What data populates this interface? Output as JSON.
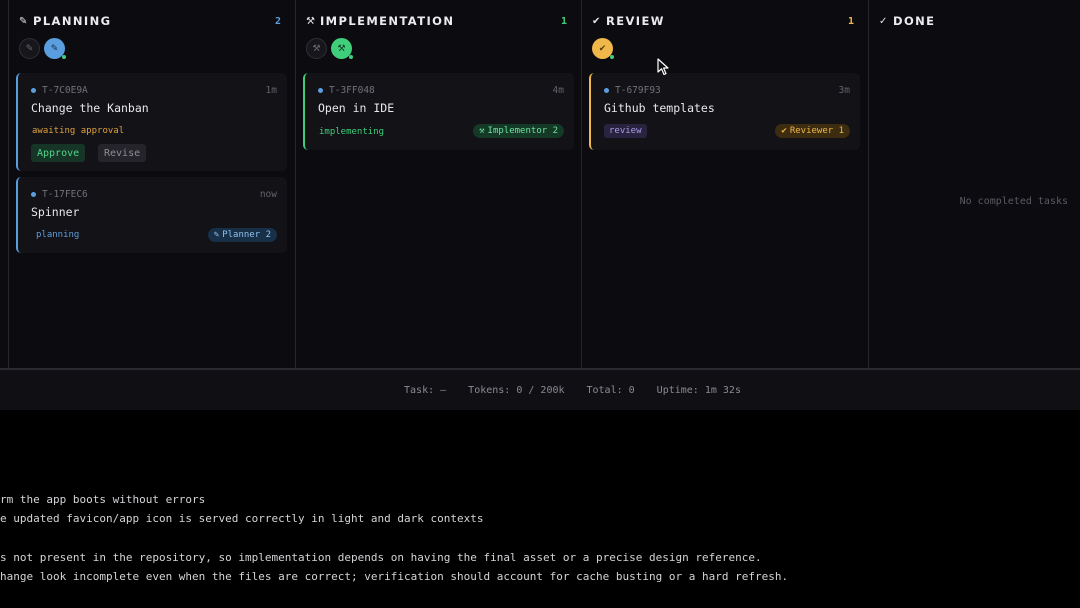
{
  "columns": [
    {
      "id": "planning",
      "glyph": "✎",
      "title": "PLANNING",
      "count": "2",
      "count_color": "#5b9ee0"
    },
    {
      "id": "implementation",
      "glyph": "⚒",
      "title": "IMPLEMENTATION",
      "count": "1",
      "count_color": "#3fcf7a"
    },
    {
      "id": "review",
      "glyph": "✔",
      "title": "REVIEW",
      "count": "1",
      "count_color": "#f0b84b"
    },
    {
      "id": "done",
      "glyph": "✓",
      "title": "DONE"
    }
  ],
  "avatars": {
    "planning": [
      {
        "icon": "✎"
      },
      {
        "icon": "✎"
      }
    ],
    "implementation": [
      {
        "icon": "⚒"
      },
      {
        "icon": "⚒"
      }
    ],
    "review": [
      {
        "icon": "✔"
      }
    ]
  },
  "cards": {
    "planning": [
      {
        "id": "T-7C0E9A",
        "age": "1m",
        "title": "Change the Kanban",
        "status": "awaiting approval",
        "actions": {
          "approve": "Approve",
          "revise": "Revise"
        }
      },
      {
        "id": "T-17FEC6",
        "age": "now",
        "title": "Spinner",
        "status": "planning",
        "agent": "Planner 2",
        "agent_icon": "✎"
      }
    ],
    "implementation": [
      {
        "id": "T-3FF048",
        "age": "4m",
        "title": "Open in IDE",
        "status": "implementing",
        "agent": "Implementor 2",
        "agent_icon": "⚒"
      }
    ],
    "review": [
      {
        "id": "T-679F93",
        "age": "3m",
        "title": "Github templates",
        "status": "review",
        "agent": "Reviewer 1",
        "agent_icon": "✔"
      }
    ]
  },
  "done_empty": "No completed tasks",
  "statusbar": {
    "task": "Task: —",
    "tokens": "Tokens: 0 / 200k",
    "total": "Total: 0",
    "uptime": "Uptime: 1m 32s"
  },
  "terminal": {
    "lines": [
      "rm the app boots without errors",
      "e updated favicon/app icon is served correctly in light and dark contexts",
      "s not present in the repository, so implementation depends on having the final asset or a precise design reference.",
      "hange look incomplete even when the files are correct; verification should account for cache busting or a hard refresh."
    ]
  },
  "colors": {
    "planning": "#5b9ee0",
    "implementation": "#3fcf7a",
    "review": "#f0b84b",
    "background": "#0c0c10",
    "card": "#121217"
  }
}
